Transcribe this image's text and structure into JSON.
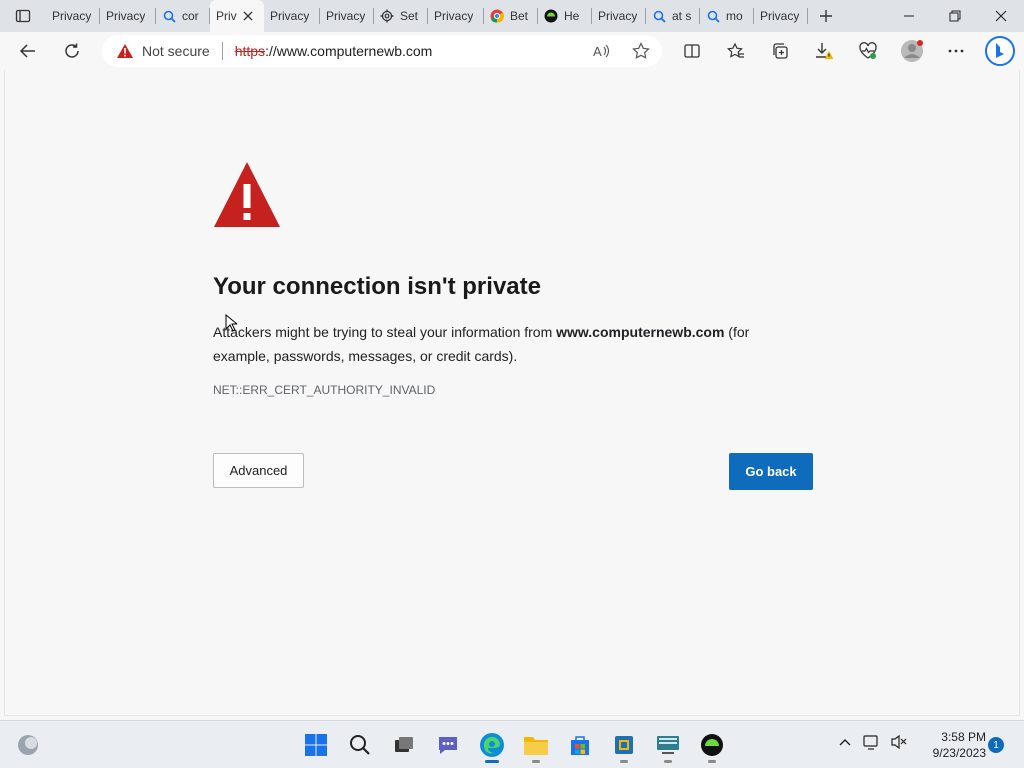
{
  "tabs": [
    {
      "title": "Privacy",
      "icon": "page-icon"
    },
    {
      "title": "Privacy",
      "icon": "page-icon"
    },
    {
      "title": "cor",
      "icon": "search-icon"
    },
    {
      "title": "Priv",
      "icon": "page-icon",
      "active": true
    },
    {
      "title": "Privacy",
      "icon": "page-icon"
    },
    {
      "title": "Privacy",
      "icon": "page-icon"
    },
    {
      "title": "Set",
      "icon": "gear-icon"
    },
    {
      "title": "Privacy",
      "icon": "page-icon"
    },
    {
      "title": "Bet",
      "icon": "chrome-icon"
    },
    {
      "title": "He",
      "icon": "green-circle-icon"
    },
    {
      "title": "Privacy",
      "icon": "page-icon"
    },
    {
      "title": "at s",
      "icon": "search-icon"
    },
    {
      "title": "mo",
      "icon": "search-icon"
    },
    {
      "title": "Privacy",
      "icon": "page-icon"
    }
  ],
  "address": {
    "security_label": "Not secure",
    "scheme": "https",
    "rest": "://www.computernewb.com"
  },
  "error_page": {
    "heading": "Your connection isn't private",
    "desc_prefix": "Attackers might be trying to steal your information from ",
    "desc_domain": "www.computernewb.com",
    "desc_suffix": " (for example, passwords, messages, or credit cards).",
    "error_code": "NET::ERR_CERT_AUTHORITY_INVALID",
    "advanced_label": "Advanced",
    "goback_label": "Go back"
  },
  "taskbar": {
    "time": "3:58 PM",
    "date": "9/23/2023",
    "notifications": "1"
  },
  "colors": {
    "accent": "#0f6cbd",
    "warning_red": "#c5221f",
    "background": "#f7f7f7"
  }
}
